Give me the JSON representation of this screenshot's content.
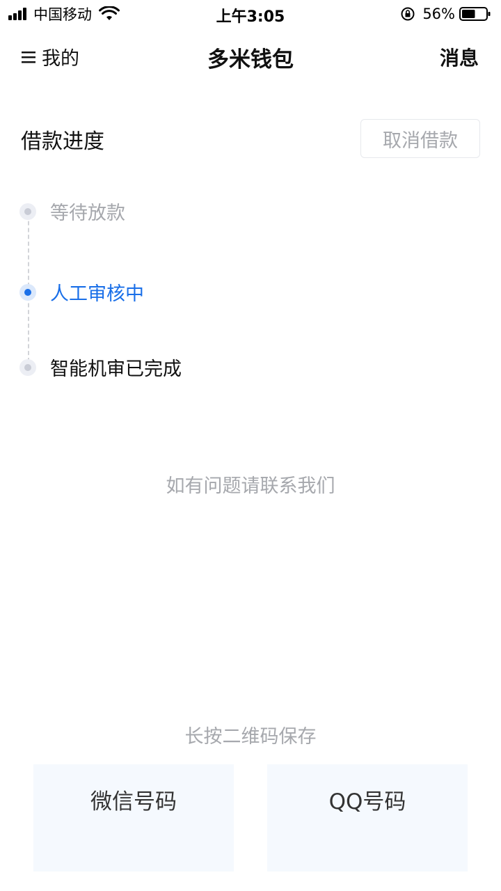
{
  "status_bar": {
    "carrier": "中国移动",
    "time": "上午3:05",
    "battery": "56%",
    "battery_level": 0.56
  },
  "nav": {
    "menu_label": "我的",
    "title": "多米钱包",
    "messages_label": "消息"
  },
  "progress": {
    "title": "借款进度",
    "cancel_label": "取消借款",
    "steps": [
      {
        "label": "等待放款",
        "state": "pending"
      },
      {
        "label": "人工审核中",
        "state": "active"
      },
      {
        "label": "智能机审已完成",
        "state": "done"
      }
    ]
  },
  "contact": {
    "text": "如有问题请联系我们",
    "save_hint": "长按二维码保存",
    "wechat_label": "微信号码",
    "qq_label": "QQ号码"
  },
  "colors": {
    "accent": "#1a6fe8",
    "muted_text": "#a6a8ad",
    "card_bg": "#f5f9fe"
  }
}
